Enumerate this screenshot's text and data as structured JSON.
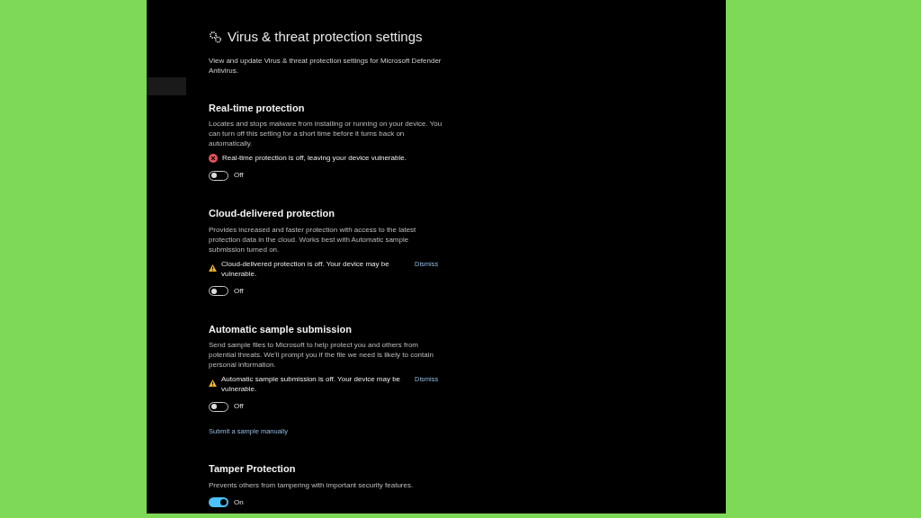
{
  "page": {
    "title": "Virus & threat protection settings",
    "subtitle": "View and update Virus & threat protection settings for Microsoft Defender Antivirus."
  },
  "sections": [
    {
      "heading": "Real-time protection",
      "description": "Locates and stops malware from installing or running on your device. You can turn off this setting for a short time before it turns back on automatically.",
      "alert": {
        "kind": "error",
        "text": "Real-time protection is off, leaving your device vulnerable."
      },
      "toggle": {
        "on": false,
        "label": "Off"
      }
    },
    {
      "heading": "Cloud-delivered protection",
      "description": "Provides increased and faster protection with access to the latest protection data in the cloud. Works best with Automatic sample submission turned on.",
      "alert": {
        "kind": "warning",
        "text": "Cloud-delivered protection is off. Your device may be vulnerable.",
        "action": "Dismiss"
      },
      "toggle": {
        "on": false,
        "label": "Off"
      }
    },
    {
      "heading": "Automatic sample submission",
      "description": "Send sample files to Microsoft to help protect you and others from potential threats. We'll prompt you if the file we need is likely to contain personal information.",
      "alert": {
        "kind": "warning",
        "text": "Automatic sample submission is off. Your device may be vulnerable.",
        "action": "Dismiss"
      },
      "toggle": {
        "on": false,
        "label": "Off"
      },
      "link": "Submit a sample manually"
    },
    {
      "heading": "Tamper Protection",
      "description": "Prevents others from tampering with important security features.",
      "toggle": {
        "on": true,
        "label": "On"
      }
    }
  ]
}
